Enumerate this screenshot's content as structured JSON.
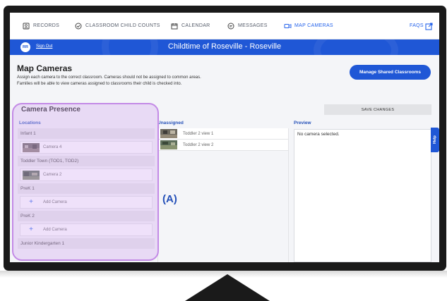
{
  "nav": {
    "items": [
      {
        "label": "RECORDS",
        "icon": "records-icon"
      },
      {
        "label": "CLASSROOM CHILD COUNTS",
        "icon": "check-circle-icon"
      },
      {
        "label": "CALENDAR",
        "icon": "calendar-icon"
      },
      {
        "label": "MESSAGES",
        "icon": "message-icon"
      },
      {
        "label": "MAP CAMERAS",
        "icon": "camera-icon"
      }
    ],
    "faqs": "FAQS"
  },
  "header": {
    "initials": "RR",
    "signout": "Sign Out",
    "title": "Childtime of Roseville - Roseville"
  },
  "page": {
    "title": "Map Cameras",
    "desc1": "Assign each camera to the correct classroom. Cameras should not be assigned to common areas.",
    "desc2": "Families will be able to view cameras assigned to classrooms their child is checked into.",
    "manage_button": "Manage Shared Classrooms",
    "save_button": "SAVE CHANGES",
    "section_title": "Camera Presence"
  },
  "locations": {
    "label": "Locations",
    "groups": [
      {
        "name": "Infant 1",
        "slot": "Camera 4"
      },
      {
        "name": "Toddler Town (TOD1, TOD2)",
        "slot": "Camera 2"
      },
      {
        "name": "PreK 1",
        "slot": "Add Camera"
      },
      {
        "name": "PreK 2",
        "slot": "Add Camera"
      },
      {
        "name": "Junior Kindergarten 1"
      }
    ]
  },
  "unassigned": {
    "label": "Unassigned",
    "items": [
      "Toddler 2 view 1",
      "Toddler 2 view 2"
    ]
  },
  "preview": {
    "label": "Preview",
    "empty_text": "No camera selected."
  },
  "help": "Help",
  "marker": "(A)",
  "colors": {
    "brand_blue": "#1f57d6",
    "active_nav": "#2563eb",
    "highlight": "#c38ae6"
  }
}
